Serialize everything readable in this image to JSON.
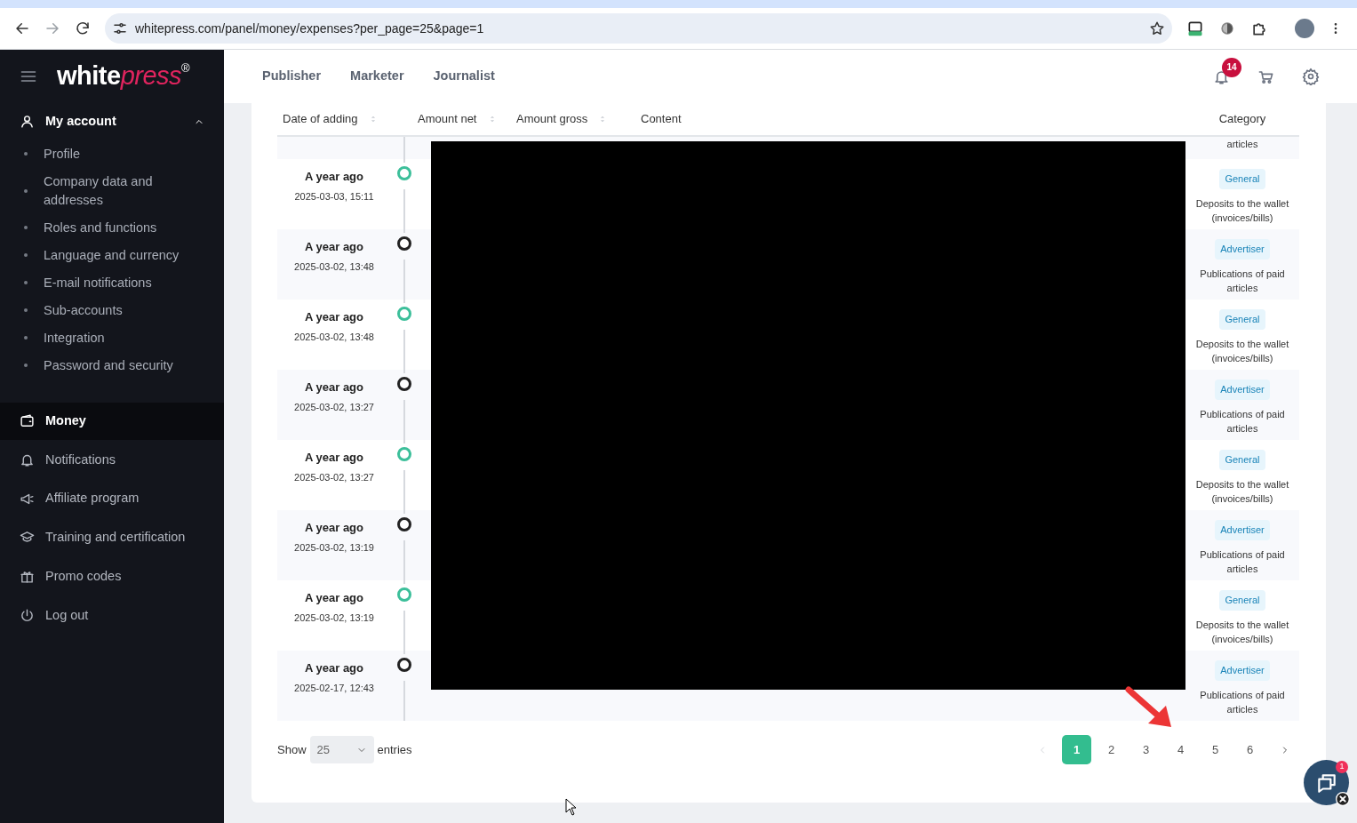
{
  "browser": {
    "url": "whitepress.com/panel/money/expenses?per_page=25&page=1"
  },
  "sidebar": {
    "logo": {
      "main": "white",
      "accent": "press",
      "mark": "®"
    },
    "menu": [
      {
        "label": "My account",
        "selected": false,
        "expanded": true,
        "children": [
          {
            "label": "Profile"
          },
          {
            "label": "Company data and addresses"
          },
          {
            "label": "Roles and functions"
          },
          {
            "label": "Language and currency"
          },
          {
            "label": "E-mail notifications"
          },
          {
            "label": "Sub-accounts"
          },
          {
            "label": "Integration"
          },
          {
            "label": "Password and security"
          }
        ]
      },
      {
        "label": "Money",
        "selected": true
      },
      {
        "label": "Notifications",
        "selected": false
      },
      {
        "label": "Affiliate program",
        "selected": false
      },
      {
        "label": "Training and certification",
        "selected": false
      },
      {
        "label": "Promo codes",
        "selected": false
      },
      {
        "label": "Log out",
        "selected": false
      }
    ]
  },
  "header": {
    "tabs": [
      "Publisher",
      "Marketer",
      "Journalist"
    ],
    "notification_count": "14"
  },
  "table": {
    "columns": [
      {
        "label": "Date of adding",
        "sortable": true
      },
      {
        "label": "Amount net",
        "sortable": true
      },
      {
        "label": "Amount gross",
        "sortable": true
      },
      {
        "label": "Content",
        "sortable": false
      },
      {
        "label": "Category",
        "sortable": false
      }
    ],
    "partial_row": {
      "category_note": "articles"
    },
    "rows": [
      {
        "time": "A year ago",
        "date": "2025-03-03, 15:11",
        "color": "#3cbf9a",
        "category": "General",
        "category_note": "Deposits to the wallet (invoices/bills)"
      },
      {
        "time": "A year ago",
        "date": "2025-03-02, 13:48",
        "color": "#222222",
        "category": "Advertiser",
        "category_note": "Publications of paid articles"
      },
      {
        "time": "A year ago",
        "date": "2025-03-02, 13:48",
        "color": "#3cbf9a",
        "category": "General",
        "category_note": "Deposits to the wallet (invoices/bills)"
      },
      {
        "time": "A year ago",
        "date": "2025-03-02, 13:27",
        "color": "#222222",
        "category": "Advertiser",
        "category_note": "Publications of paid articles"
      },
      {
        "time": "A year ago",
        "date": "2025-03-02, 13:27",
        "color": "#3cbf9a",
        "category": "General",
        "category_note": "Deposits to the wallet (invoices/bills)"
      },
      {
        "time": "A year ago",
        "date": "2025-03-02, 13:19",
        "color": "#222222",
        "category": "Advertiser",
        "category_note": "Publications of paid articles"
      },
      {
        "time": "A year ago",
        "date": "2025-03-02, 13:19",
        "color": "#3cbf9a",
        "category": "General",
        "category_note": "Deposits to the wallet (invoices/bills)"
      },
      {
        "time": "A year ago",
        "date": "2025-02-17, 12:43",
        "color": "#222222",
        "category": "Advertiser",
        "category_note": "Publications of paid articles"
      }
    ]
  },
  "footer": {
    "show_label": "Show",
    "per_page": "25",
    "entries_label": "entries",
    "pagination": {
      "prev_disabled": true,
      "next_disabled": false,
      "pages": [
        {
          "label": "1",
          "selected": true
        },
        {
          "label": "2",
          "selected": false
        },
        {
          "label": "3",
          "selected": false
        },
        {
          "label": "4",
          "selected": false
        },
        {
          "label": "5",
          "selected": false
        },
        {
          "label": "6",
          "selected": false
        }
      ]
    }
  },
  "chat": {
    "badge": "1"
  }
}
